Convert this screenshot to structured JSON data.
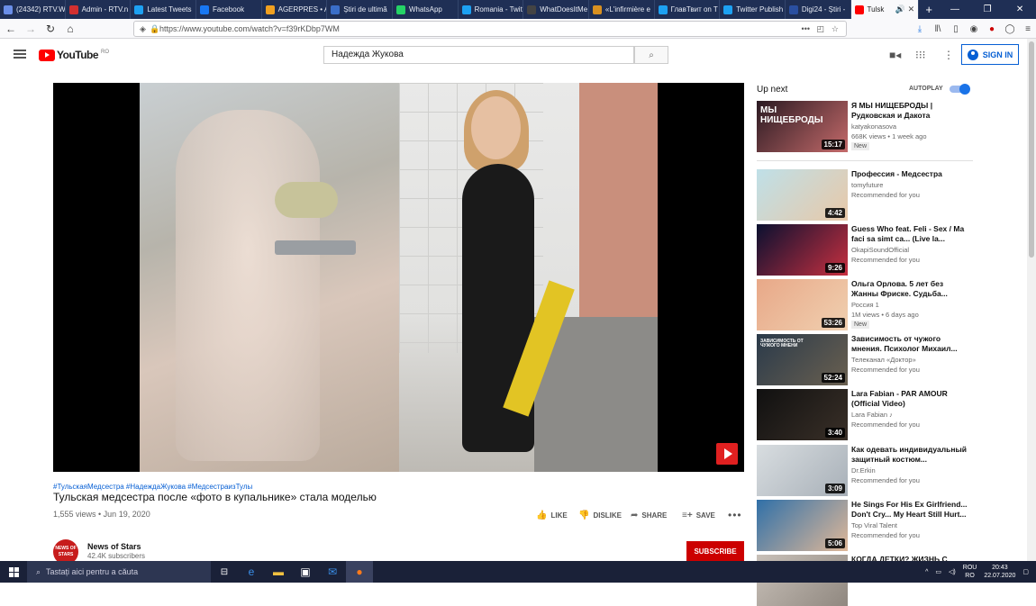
{
  "browser": {
    "tabs": [
      {
        "label": "(24342) RTV.We",
        "color": "#6a8ee8"
      },
      {
        "label": "Admin - RTV.n",
        "color": "#d23030"
      },
      {
        "label": "Latest Tweets",
        "color": "#1da1f2"
      },
      {
        "label": "Facebook",
        "color": "#1877f2"
      },
      {
        "label": "AGERPRES • A",
        "color": "#f0a020"
      },
      {
        "label": "Știri de ultimă",
        "color": "#3a6ec8"
      },
      {
        "label": "WhatsApp",
        "color": "#25d366"
      },
      {
        "label": "Romania - Twitt",
        "color": "#1da1f2"
      },
      {
        "label": "WhatDoesItMe",
        "color": "#444444"
      },
      {
        "label": "«L'infirmière e",
        "color": "#d89020"
      },
      {
        "label": "ГлавТвит on T",
        "color": "#1da1f2"
      },
      {
        "label": "Twitter Publish",
        "color": "#1da1f2"
      },
      {
        "label": "Digi24 - Știri -",
        "color": "#2a4fa0"
      },
      {
        "label": "Tulsk",
        "color": "#ff0000",
        "active": true
      }
    ],
    "url": "https://www.youtube.com/watch?v=f39rKDbp7WM"
  },
  "header": {
    "logo_text": "YouTube",
    "logo_country": "RO",
    "search_value": "Надежда Жукова",
    "sign_in_label": "SIGN IN"
  },
  "video": {
    "hashtags": "#ТульскаяМедсестра #НадеждаЖукова #МедсестраизТулы",
    "title": "Тульская медсестра после «фото в купальнике» стала моделью",
    "views_date": "1,555 views • Jun 19, 2020",
    "like_label": "LIKE",
    "dislike_label": "DISLIKE",
    "share_label": "SHARE",
    "save_label": "SAVE",
    "more_label": "•••"
  },
  "channel": {
    "avatar_text": "NEWS OF STARS",
    "name": "News of Stars",
    "subscribers": "42.4K subscribers",
    "subscribe_label": "SUBSCRIBE"
  },
  "sidebar": {
    "up_next": "Up next",
    "autoplay": "AUTOPLAY",
    "videos": [
      {
        "title": "Я МЫ НИЩЕБРОДЫ | Рудковская и Дакота",
        "channel": "katyakonasova",
        "meta": "668K views • 1 week ago",
        "badge": "New",
        "duration": "15:17",
        "thumb_a": "#2a1a22",
        "thumb_b": "#c46a6a",
        "thumb_text": "МЫ НИЩЕБРОДЫ"
      },
      {
        "title": "Профессия - Медсестра",
        "channel": "tomyfuture",
        "meta": "Recommended for you",
        "badge": "",
        "duration": "4:42",
        "thumb_a": "#bfe0e8",
        "thumb_b": "#e8c8a8",
        "thumb_text": ""
      },
      {
        "title": "Guess Who feat. Feli - Sex / Ma faci sa simt ca... (Live la...",
        "channel": "OkapiSoundOfficial",
        "meta": "Recommended for you",
        "badge": "",
        "duration": "9:26",
        "thumb_a": "#0a1030",
        "thumb_b": "#c83040",
        "thumb_text": ""
      },
      {
        "title": "Ольга Орлова. 5 лет без Жанны Фриске. Судьба...",
        "channel": "Россия 1",
        "meta": "1M views • 6 days ago",
        "badge": "New",
        "duration": "53:26",
        "thumb_a": "#e8a888",
        "thumb_b": "#f0d0b0",
        "thumb_text": ""
      },
      {
        "title": "Зависимость от чужого мнения. Психолог Михаил...",
        "channel": "Телеканал «Доктор»",
        "meta": "Recommended for you",
        "badge": "",
        "duration": "52:24",
        "thumb_a": "#2a3a4a",
        "thumb_b": "#6a6050",
        "thumb_text": "ЗАВИСИМОСТЬ ОТ ЧУЖОГО МНЕНИ"
      },
      {
        "title": "Lara Fabian - PAR AMOUR (Official Video)",
        "channel": "Lara Fabian ♪",
        "meta": "Recommended for you",
        "badge": "",
        "duration": "3:40",
        "thumb_a": "#101010",
        "thumb_b": "#3a3028",
        "thumb_text": ""
      },
      {
        "title": "Как одевать индивидуальный защитный костюм...",
        "channel": "Dr.Erkin",
        "meta": "Recommended for you",
        "badge": "",
        "duration": "3:09",
        "thumb_a": "#d8dde0",
        "thumb_b": "#a8b0b8",
        "thumb_text": ""
      },
      {
        "title": "He Sings For His Ex Girlfriend... Don't Cry... My Heart Still Hurt...",
        "channel": "Top Viral Talent",
        "meta": "Recommended for you",
        "badge": "",
        "duration": "5:06",
        "thumb_a": "#3070a8",
        "thumb_b": "#e0b898",
        "thumb_text": ""
      },
      {
        "title": "КОГДА ДЕТКИ? ЖИЗНЬ С",
        "channel": "",
        "meta": "",
        "badge": "",
        "duration": "",
        "thumb_a": "#c8c0b8",
        "thumb_b": "#908880",
        "thumb_text": ""
      }
    ]
  },
  "taskbar": {
    "search_placeholder": "Tastați aici pentru a căuta",
    "lang_top": "ROU",
    "lang_bottom": "RO",
    "time": "20:43",
    "date": "22.07.2020"
  }
}
